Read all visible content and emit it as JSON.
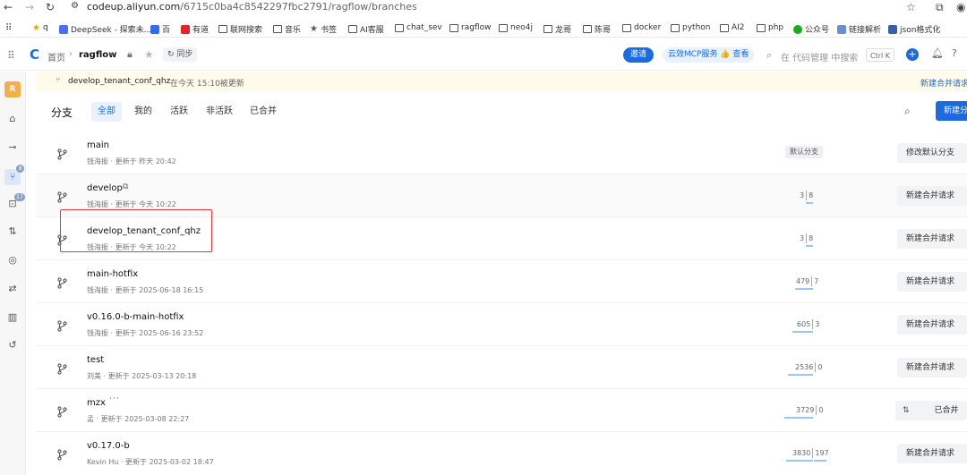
{
  "browser": {
    "url_host": "codeup.aliyun.com",
    "url_path": "/6715c0ba4c8542297fbc2791/ragflow/branches",
    "bookmarks": [
      {
        "label": "q",
        "icon": "star-icon"
      },
      {
        "label": "DeepSeek - 探索未...",
        "icon": "deepseek-icon"
      },
      {
        "label": "百",
        "icon": "baidu-icon"
      },
      {
        "label": "有道",
        "icon": "youdao-icon"
      },
      {
        "label": "联网搜索",
        "icon": "folder-icon"
      },
      {
        "label": "音乐",
        "icon": "folder-icon"
      },
      {
        "label": "书签",
        "icon": "star-icon"
      },
      {
        "label": "AI客服",
        "icon": "folder-icon"
      },
      {
        "label": "chat_sev",
        "icon": "folder-icon"
      },
      {
        "label": "ragflow",
        "icon": "folder-icon"
      },
      {
        "label": "neo4j",
        "icon": "folder-icon"
      },
      {
        "label": "龙哥",
        "icon": "folder-icon"
      },
      {
        "label": "陈哥",
        "icon": "folder-icon"
      },
      {
        "label": "docker",
        "icon": "folder-icon"
      },
      {
        "label": "python",
        "icon": "folder-icon"
      },
      {
        "label": "AI2",
        "icon": "folder-icon"
      },
      {
        "label": "php",
        "icon": "folder-icon"
      },
      {
        "label": "公众号",
        "icon": "wechat-icon"
      },
      {
        "label": "链接解析",
        "icon": "link-icon"
      },
      {
        "label": "json格式化",
        "icon": "json-icon"
      }
    ]
  },
  "header": {
    "home": "首页",
    "repo": "ragflow",
    "sync": "同步",
    "invite": "邀请",
    "mcp": "云效MCP服务",
    "mcp_view": "查看",
    "search_placeholder": "在 代码管理 中搜索",
    "shortcut": "Ctrl K"
  },
  "sidebar": {
    "avatar": "R",
    "badge_branch": "8",
    "badge_mr": "17"
  },
  "notice": {
    "branch": "develop_tenant_conf_qhz",
    "text": "在今天 15:10被更新",
    "action": "新建合并请求"
  },
  "page": {
    "title": "分支",
    "tabs": [
      "全部",
      "我的",
      "活跃",
      "非活跃",
      "已合并"
    ],
    "new_button": "新建分支"
  },
  "branches": [
    {
      "name": "main",
      "meta": "钱海振 · 更新于 昨天 20:42",
      "tag": "默认分支",
      "button": "修改默认分支"
    },
    {
      "name": "develop",
      "meta": "钱海振 · 更新于 今天 10:22",
      "behind": "3",
      "ahead": "8",
      "button": "新建合并请求"
    },
    {
      "name": "develop_tenant_conf_qhz",
      "meta": "钱海振 · 更新于 今天 10:22",
      "behind": "3",
      "ahead": "8",
      "button": "新建合并请求"
    },
    {
      "name": "main-hotfix",
      "meta": "钱海振 · 更新于 2025-06-18 16:15",
      "behind": "479",
      "ahead": "7",
      "button": "新建合并请求"
    },
    {
      "name": "v0.16.0-b-main-hotfix",
      "meta": "钱海振 · 更新于 2025-06-16 23:52",
      "behind": "605",
      "ahead": "3",
      "button": "新建合并请求"
    },
    {
      "name": "test",
      "meta": "刘美 · 更新于 2025-03-13 20:18",
      "behind": "2536",
      "ahead": "0",
      "button": "新建合并请求"
    },
    {
      "name": "mzx",
      "meta": "孟 · 更新于 2025-03-08 22:27",
      "behind": "3729",
      "ahead": "0",
      "button": "已合并"
    },
    {
      "name": "v0.17.0-b",
      "meta": "Kevin Hu · 更新于 2025-03-02 18:47",
      "behind": "3830",
      "ahead": "197",
      "button": "新建合并请求"
    }
  ]
}
